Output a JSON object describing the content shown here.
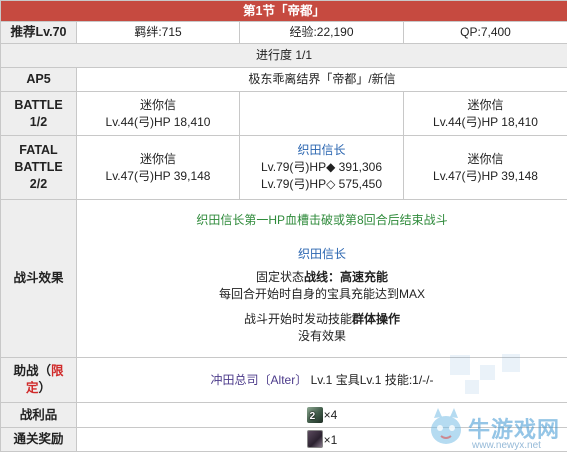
{
  "title": "第1节「帝都」",
  "recommend": {
    "label": "推荐Lv.70",
    "bond": "羁绊:715",
    "exp": "经验:22,190",
    "qp": "QP:7,400"
  },
  "progress": "进行度 1/1",
  "ap": {
    "label": "AP5",
    "location": "极东乖离结界「帝都」/新信"
  },
  "battle1": {
    "label_line1": "BATTLE",
    "label_line2": "1/2",
    "left": {
      "name": "迷你信",
      "stats": "Lv.44(弓)HP 18,410"
    },
    "right": {
      "name": "迷你信",
      "stats": "Lv.44(弓)HP 18,410"
    }
  },
  "battle2": {
    "label_line1": "FATAL",
    "label_line2": "BATTLE",
    "label_line3": "2/2",
    "left": {
      "name": "迷你信",
      "stats": "Lv.47(弓)HP 39,148"
    },
    "center": {
      "name": "织田信长",
      "hp1": "Lv.79(弓)HP◆ 391,306",
      "hp2": "Lv.79(弓)HP◇ 575,450"
    },
    "right": {
      "name": "迷你信",
      "stats": "Lv.47(弓)HP 39,148"
    }
  },
  "effects": {
    "label": "战斗效果",
    "condition": "织田信长第一HP血槽击破或第8回合后结束战斗",
    "boss_name": "织田信长",
    "state_prefix": "固定状态",
    "state_name": "战线：高速充能",
    "state_desc": "每回合开始时自身的宝具充能达到MAX",
    "skill_prefix": "战斗开始时发动技能",
    "skill_name": "群体操作",
    "skill_result": "没有效果"
  },
  "support": {
    "label_prefix": "助战（",
    "label_limit": "限定",
    "label_suffix": "）",
    "servant": "冲田总司〔Alter〕",
    "details": "Lv.1 宝具Lv.1 技能:1/-/-"
  },
  "drops": {
    "label": "战利品",
    "item_num": "2",
    "count": "×4"
  },
  "reward": {
    "label": "通关奖励",
    "count": "×1"
  },
  "watermark": {
    "text": "牛游戏网",
    "url": "www.newyx.net"
  },
  "colors": {
    "header": "#c64a40",
    "label_bg": "#eeeeee",
    "blue": "#2a65b0",
    "green": "#2e8a3a",
    "red": "#d02a2a"
  }
}
